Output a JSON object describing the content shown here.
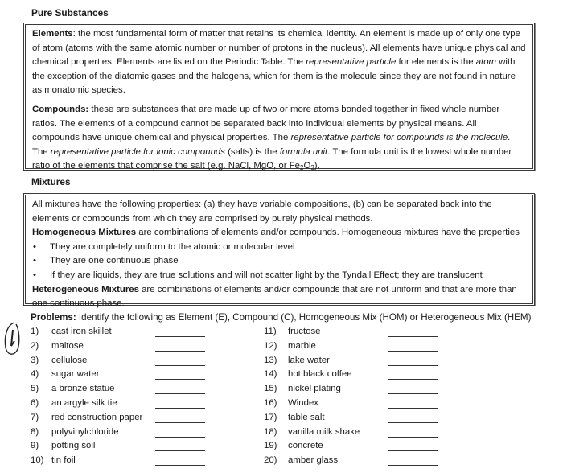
{
  "pure_substances": {
    "heading": "Pure Substances",
    "elements": {
      "label": "Elements",
      "t1": ": the most fundamental form of matter that retains its chemical identity. An element is made up of only one type of atom (atoms with the same atomic number or number of protons in the nucleus). All elements have unique physical and chemical properties. Elements are listed on the Periodic Table. The ",
      "i1": "representative particle",
      "t2": " for elements is the ",
      "i2": "atom",
      "t3": " with the exception of the diatomic gases and the halogens, which for them is the molecule since they are not found in nature as monatomic species."
    },
    "compounds": {
      "label": "Compounds:",
      "t1": " these are substances that are made up of two or more atoms bonded together in fixed whole number ratios. The elements of a compound cannot be separated back into individual elements by physical means. All compounds have unique chemical and physical properties. The ",
      "i1": "representative particle for compounds is the molecule",
      "t2": ". The ",
      "i2": "representative particle for ionic compounds",
      "t3": " (salts) is the ",
      "i3": "formula unit",
      "t4": ". The formula unit is the lowest whole number ratio of the elements that comprise the salt (e.g. NaCl, MgO, or Fe",
      "sub1": "2",
      "t5": "O",
      "sub2": "3",
      "t6": ")."
    }
  },
  "mixtures": {
    "heading": "Mixtures",
    "intro": "All mixtures have the following properties: (a) they have variable compositions, (b) can be separated back into the elements or compounds from which they are comprised by purely physical methods.",
    "homogeneous_label": "Homogeneous Mixtures",
    "homogeneous_text": " are combinations of elements and/or compounds. Homogeneous mixtures have the properties",
    "bullet_char": "•",
    "bullets": [
      "They are completely uniform to the atomic or molecular level",
      "They are one continuous phase",
      "If they are liquids, they are true solutions and will not scatter light by the Tyndall Effect; they are translucent"
    ],
    "heterogeneous_label": "Heterogeneous Mixtures",
    "heterogeneous_text": " are combinations of elements and/or compounds that are not uniform and that are more than one continuous phase."
  },
  "problems": {
    "label": "Problems:",
    "instruction": " Identify the following as Element (E), Compound (C), Homogeneous Mix (HOM) or Heterogeneous Mix (HEM)",
    "annotation": "handwritten-circled-1",
    "items_left": [
      {
        "num": "1)",
        "text": "cast iron skillet"
      },
      {
        "num": "2)",
        "text": "maltose"
      },
      {
        "num": "3)",
        "text": "cellulose"
      },
      {
        "num": "4)",
        "text": "sugar water"
      },
      {
        "num": "5)",
        "text": "a bronze statue"
      },
      {
        "num": "6)",
        "text": "an argyle silk tie"
      },
      {
        "num": "7)",
        "text": "red construction paper"
      },
      {
        "num": "8)",
        "text": "polyvinylchloride"
      },
      {
        "num": "9)",
        "text": "potting soil"
      },
      {
        "num": "10)",
        "text": "tin foil"
      }
    ],
    "items_right": [
      {
        "num": "11)",
        "text": "fructose"
      },
      {
        "num": "12)",
        "text": "marble"
      },
      {
        "num": "13)",
        "text": "lake water"
      },
      {
        "num": "14)",
        "text": "hot black coffee"
      },
      {
        "num": "15)",
        "text": "nickel plating"
      },
      {
        "num": "16)",
        "text": "Windex"
      },
      {
        "num": "17)",
        "text": "table salt"
      },
      {
        "num": "18)",
        "text": "vanilla milk shake"
      },
      {
        "num": "19)",
        "text": "concrete"
      },
      {
        "num": "20)",
        "text": "amber glass"
      }
    ]
  }
}
